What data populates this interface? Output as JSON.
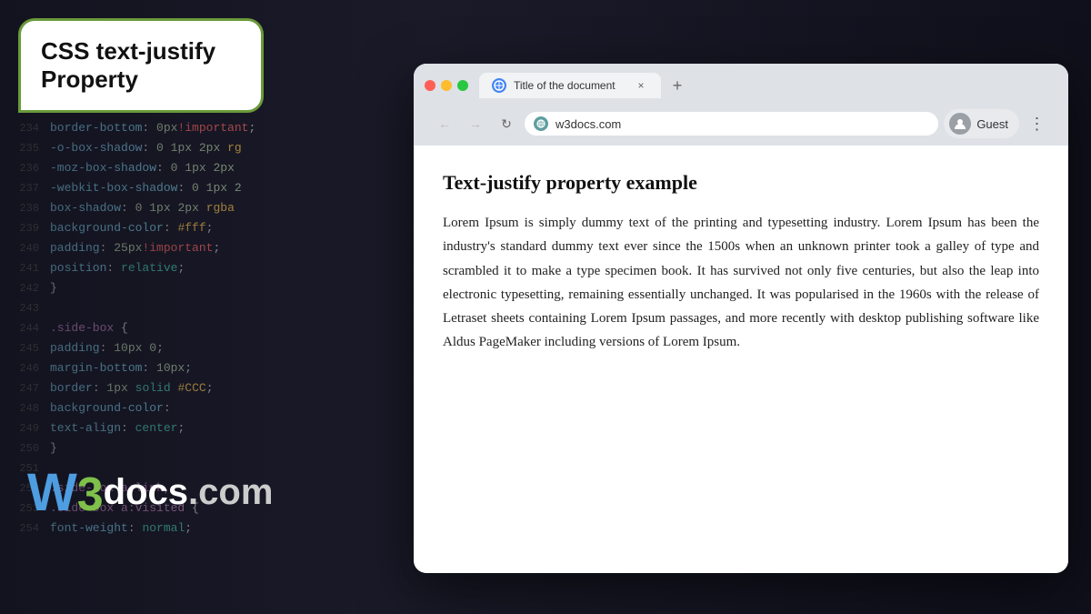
{
  "page": {
    "title": "CSS text-justify Property",
    "background": {
      "code_lines": [
        {
          "num": "234",
          "text": "border-bottom: 0px!important;"
        },
        {
          "num": "235",
          "text": "-o-box-shadow: 0 1px 2px rg..."
        },
        {
          "num": "236",
          "text": "-moz-box-shadow: 0 1px 2px..."
        },
        {
          "num": "237",
          "text": "-webkit-box-shadow: 0 1px 2..."
        },
        {
          "num": "238",
          "text": "box-shadow: 0 1px 2px rgba..."
        },
        {
          "num": "239",
          "text": "background-color: #fff;"
        },
        {
          "num": "240",
          "text": "padding: 25px!important;"
        },
        {
          "num": "241",
          "text": "position: relative;"
        },
        {
          "num": "242",
          "text": "}"
        },
        {
          "num": "243",
          "text": ""
        },
        {
          "num": "244",
          "text": ".side-box {"
        },
        {
          "num": "245",
          "text": "padding: 10px 0;"
        },
        {
          "num": "246",
          "text": "margin-bottom: 10px;"
        },
        {
          "num": "247",
          "text": "border: 1px solid #CCC;"
        },
        {
          "num": "248",
          "text": "background-color: ..."
        },
        {
          "num": "249",
          "text": "text-align: center;"
        },
        {
          "num": "250",
          "text": "}"
        },
        {
          "num": "251",
          "text": ""
        },
        {
          "num": "252",
          "text": ".side-box a:link,"
        },
        {
          "num": "253",
          "text": ".side-box a:visited {"
        },
        {
          "num": "254",
          "text": "font-weight: normal;"
        }
      ]
    }
  },
  "logo": {
    "w3_text": "W",
    "three_text": "3",
    "docs_text": "docs",
    "com_text": ".com"
  },
  "browser": {
    "tab": {
      "title": "Title of the document",
      "close_label": "×",
      "new_tab_label": "+"
    },
    "nav": {
      "back_label": "←",
      "forward_label": "→",
      "reload_label": "↻"
    },
    "address_bar": {
      "url": "w3docs.com"
    },
    "profile": {
      "label": "Guest"
    },
    "menu_label": "⋮"
  },
  "content": {
    "heading": "Text-justify property example",
    "paragraph": "Lorem Ipsum is simply dummy text of the printing and typesetting industry. Lorem Ipsum has been the industry's standard dummy text ever since the 1500s when an unknown printer took a galley of type and scrambled it to make a type specimen book. It has survived not only five centuries, but also the leap into electronic typesetting, remaining essentially unchanged. It was popularised in the 1960s with the release of Letraset sheets containing Lorem Ipsum passages, and more recently with desktop publishing software like Aldus PageMaker including versions of Lorem Ipsum."
  }
}
